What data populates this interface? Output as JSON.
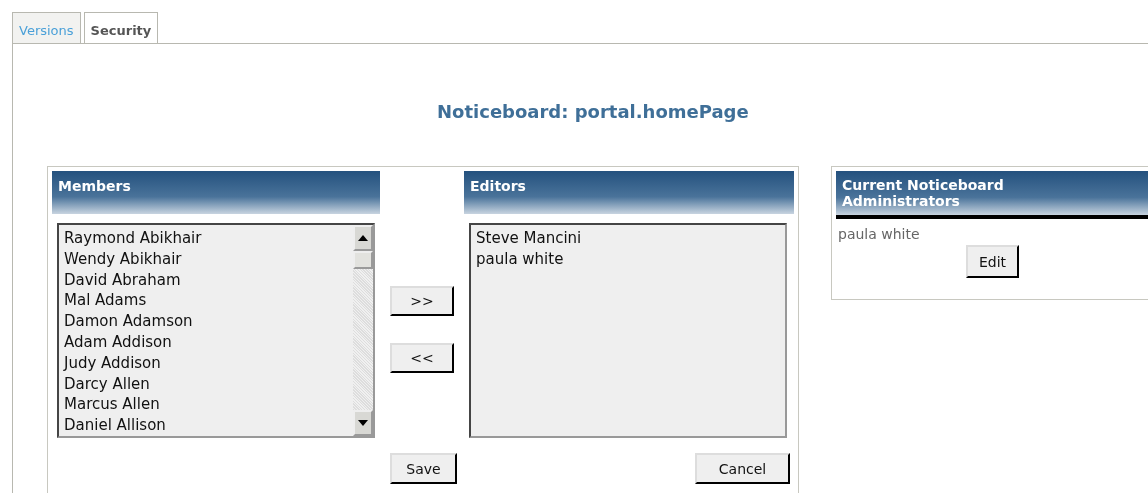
{
  "tabs": [
    {
      "label": "Versions",
      "selected": false
    },
    {
      "label": "Security",
      "selected": true
    }
  ],
  "title": "Noticeboard: portal.homePage",
  "members": {
    "heading": "Members",
    "items": [
      "Raymond Abikhair",
      "Wendy Abikhair",
      "David Abraham",
      "Mal Adams",
      "Damon Adamson",
      "Adam Addison",
      "Judy Addison",
      "Darcy Allen",
      "Marcus Allen",
      "Daniel Allison"
    ]
  },
  "move_buttons": [
    ">>",
    "<<"
  ],
  "editors": {
    "heading": "Editors",
    "items": [
      "Steve Mancini",
      "paula white"
    ]
  },
  "save_button": "Save",
  "cancel_button": "Cancel",
  "administrators": {
    "heading": "Current Noticeboard Administrators",
    "items": [
      "paula white"
    ],
    "edit_button": "Edit"
  }
}
